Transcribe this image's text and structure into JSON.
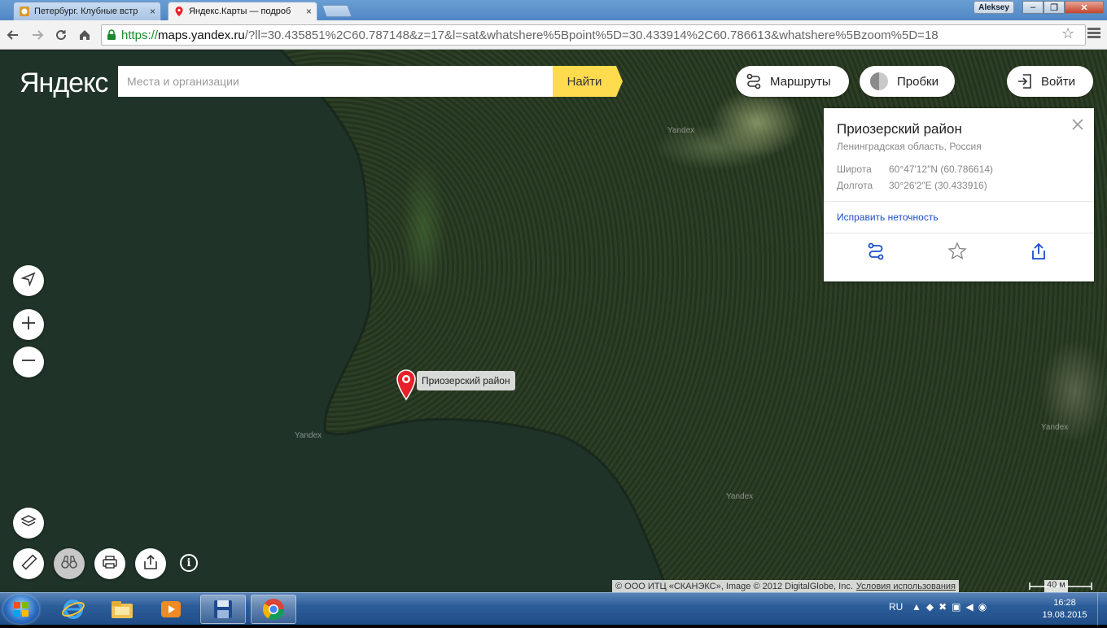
{
  "browser": {
    "tabs": [
      {
        "title": "Петербург. Клубные встр",
        "close": "×"
      },
      {
        "title": "Яндекс.Карты — подроб",
        "close": "×"
      }
    ],
    "user": "Aleksey",
    "window_controls": {
      "minimize": "–",
      "maximize": "❐",
      "close": "✕"
    },
    "url": {
      "scheme": "https://",
      "host": "maps.yandex.ru",
      "rest": "/?ll=30.435851%2C60.787148&z=17&l=sat&whatshere%5Bpoint%5D=30.433914%2C60.786613&whatshere%5Bzoom%5D=18"
    }
  },
  "header": {
    "logo": "Яндекс",
    "search_placeholder": "Места и организации",
    "search_button": "Найти",
    "routes": "Маршруты",
    "traffic": "Пробки",
    "login": "Войти"
  },
  "card": {
    "title": "Приозерский район",
    "subtitle": "Ленинградская область, Россия",
    "lat_label": "Широта",
    "lat_value": "60°47′12″N (60.786614)",
    "lon_label": "Долгота",
    "lon_value": "30°26′2″E (30.433916)",
    "fix_link": "Исправить неточность"
  },
  "marker": {
    "label": "Приозерский район"
  },
  "watermarks": [
    "Yandex",
    "Yandex",
    "Yandex",
    "Yandex"
  ],
  "footer": {
    "copyright": "© ООО ИТЦ «СКАНЭКС», Image © 2012 DigitalGlobe, Inc.",
    "terms": "Условия использования",
    "scale": "40 м"
  },
  "taskbar": {
    "lang": "RU",
    "time": "16:28",
    "date": "19.08.2015"
  },
  "colors": {
    "accent_yellow": "#ffdb4d",
    "link_blue": "#1a4ec9",
    "marker_red": "#e8202a"
  }
}
